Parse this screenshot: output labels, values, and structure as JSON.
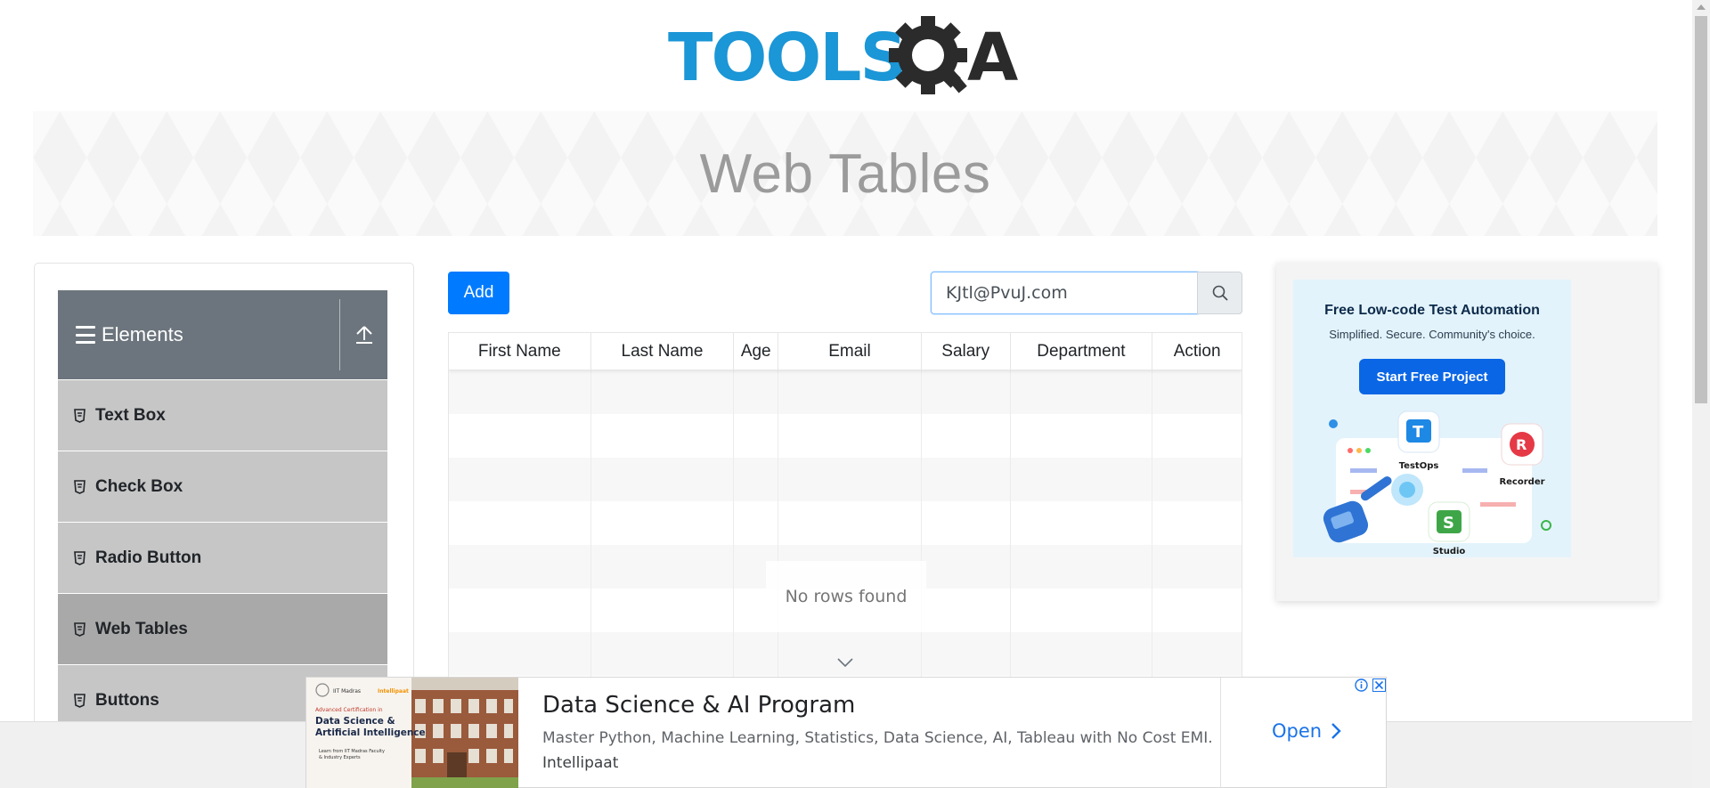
{
  "header": {
    "logo_text": "TOOLSQA"
  },
  "banner": {
    "title": "Web Tables"
  },
  "sidebar": {
    "group_title": "Elements",
    "items": [
      {
        "label": "Text Box",
        "active": false
      },
      {
        "label": "Check Box",
        "active": false
      },
      {
        "label": "Radio Button",
        "active": false
      },
      {
        "label": "Web Tables",
        "active": true
      },
      {
        "label": "Buttons",
        "active": false
      }
    ]
  },
  "toolbar": {
    "add_label": "Add",
    "search_value": "KJtl@PvuJ.com"
  },
  "table": {
    "columns": [
      "First Name",
      "Last Name",
      "Age",
      "Email",
      "Salary",
      "Department",
      "Action"
    ],
    "empty_message": "No rows found"
  },
  "side_ad": {
    "title": "Free Low-code Test Automation",
    "subtitle": "Simplified. Secure. Community's choice.",
    "cta": "Start Free Project",
    "labels": [
      "TestOps",
      "Recorder",
      "Studio"
    ]
  },
  "bottom_ad": {
    "image_text": {
      "org": "IIT Madras",
      "partner": "Intellipaat",
      "tag": "Advanced Certification in",
      "course_line1": "Data Science &",
      "course_line2": "Artificial Intelligence",
      "footer_line1": "Learn from IIT Madras Faculty",
      "footer_line2": "& Industry Experts"
    },
    "headline": "Data Science & AI Program",
    "description": "Master Python, Machine Learning, Statistics, Data Science, AI, Tableau with No Cost EMI.",
    "brand": "Intellipaat",
    "cta": "Open"
  },
  "colors": {
    "primary": "#007bff",
    "sidebar_header": "#6c757d",
    "menu_item": "#c6c6c6",
    "menu_item_active": "#a9a9a9"
  }
}
